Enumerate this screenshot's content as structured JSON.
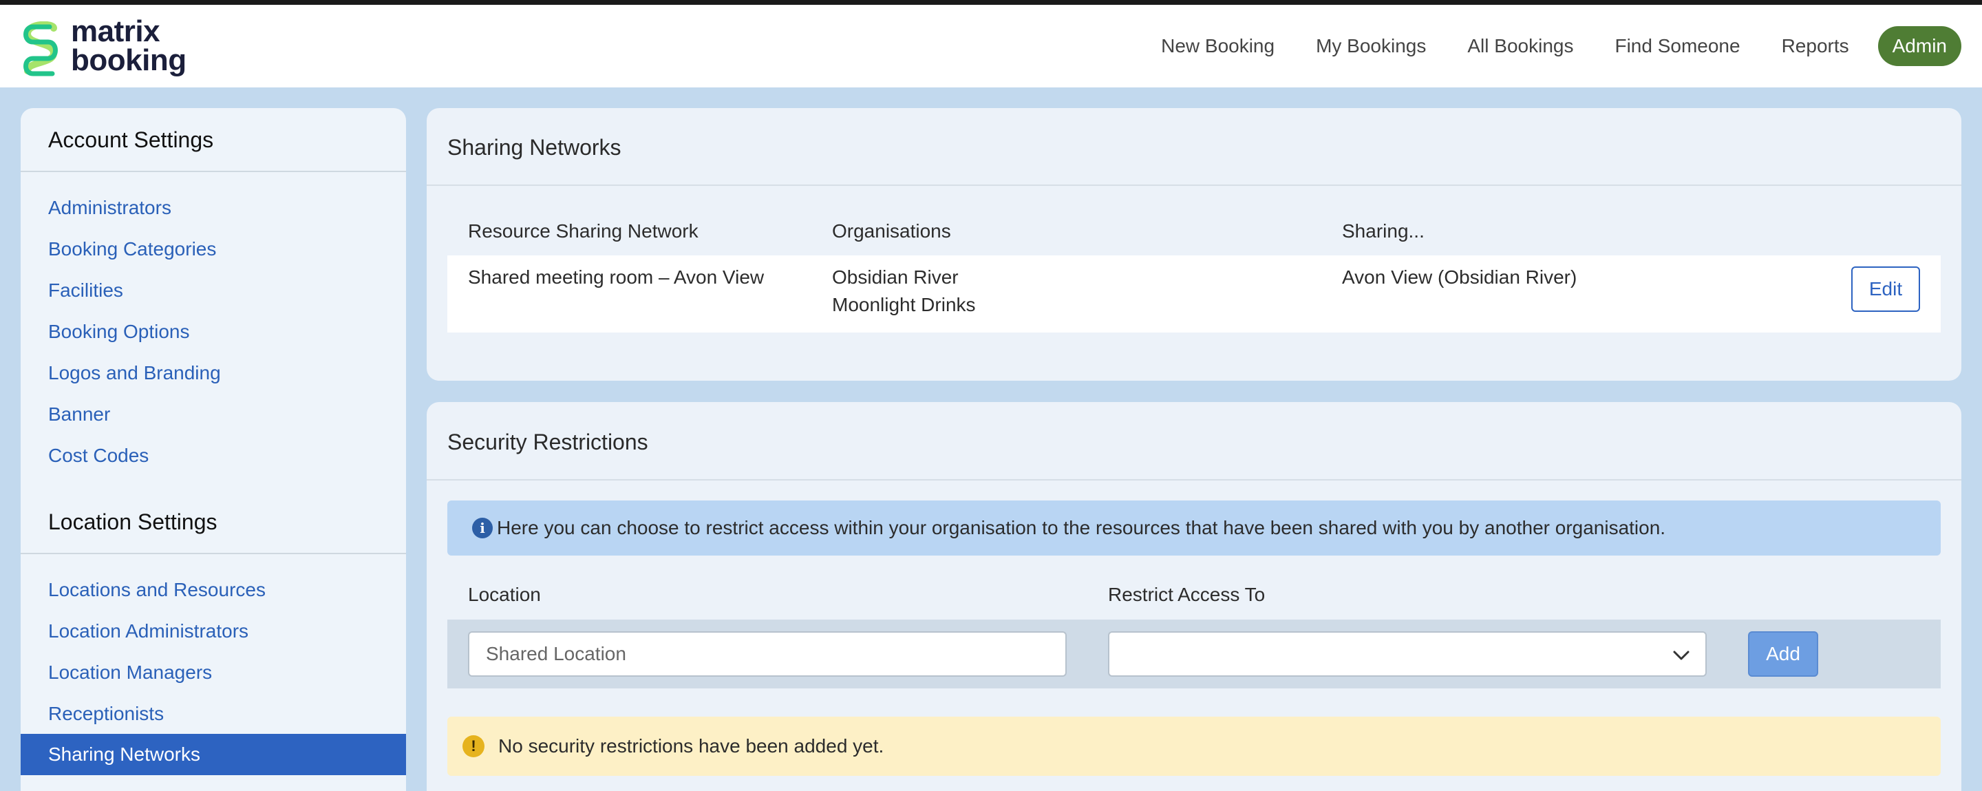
{
  "brand": {
    "name_line1": "matrix",
    "name_line2": "booking",
    "colors": {
      "logo_green_dark": "#22c48a",
      "logo_green_light": "#a6e36b",
      "accent_blue": "#2d63c1",
      "admin_green": "#4f7d34"
    }
  },
  "nav": {
    "items": [
      "New Booking",
      "My Bookings",
      "All Bookings",
      "Find Someone",
      "Reports"
    ],
    "admin_label": "Admin"
  },
  "sidebar": {
    "account_heading": "Account Settings",
    "account_items": [
      "Administrators",
      "Booking Categories",
      "Facilities",
      "Booking Options",
      "Logos and Branding",
      "Banner",
      "Cost Codes"
    ],
    "location_heading": "Location Settings",
    "location_items": [
      "Locations and Resources",
      "Location Administrators",
      "Location Managers",
      "Receptionists"
    ],
    "active_item": "Sharing Networks"
  },
  "sharing": {
    "title": "Sharing Networks",
    "columns": [
      "Resource Sharing Network",
      "Organisations",
      "Sharing..."
    ],
    "rows": [
      {
        "network": "Shared meeting room – Avon View",
        "organisations": [
          "Obsidian River",
          "Moonlight Drinks"
        ],
        "sharing": "Avon View (Obsidian River)",
        "action": "Edit"
      }
    ]
  },
  "security": {
    "title": "Security Restrictions",
    "info_icon": "info-circle-icon",
    "info_text": "Here you can choose to restrict access within your organisation to the resources that have been shared with you by another organisation.",
    "location_label": "Location",
    "restrict_label": "Restrict Access To",
    "location_placeholder": "Shared Location",
    "restrict_value": "",
    "add_label": "Add",
    "warning_icon": "exclamation-circle-icon",
    "warning_text": "No security restrictions have been added yet."
  }
}
